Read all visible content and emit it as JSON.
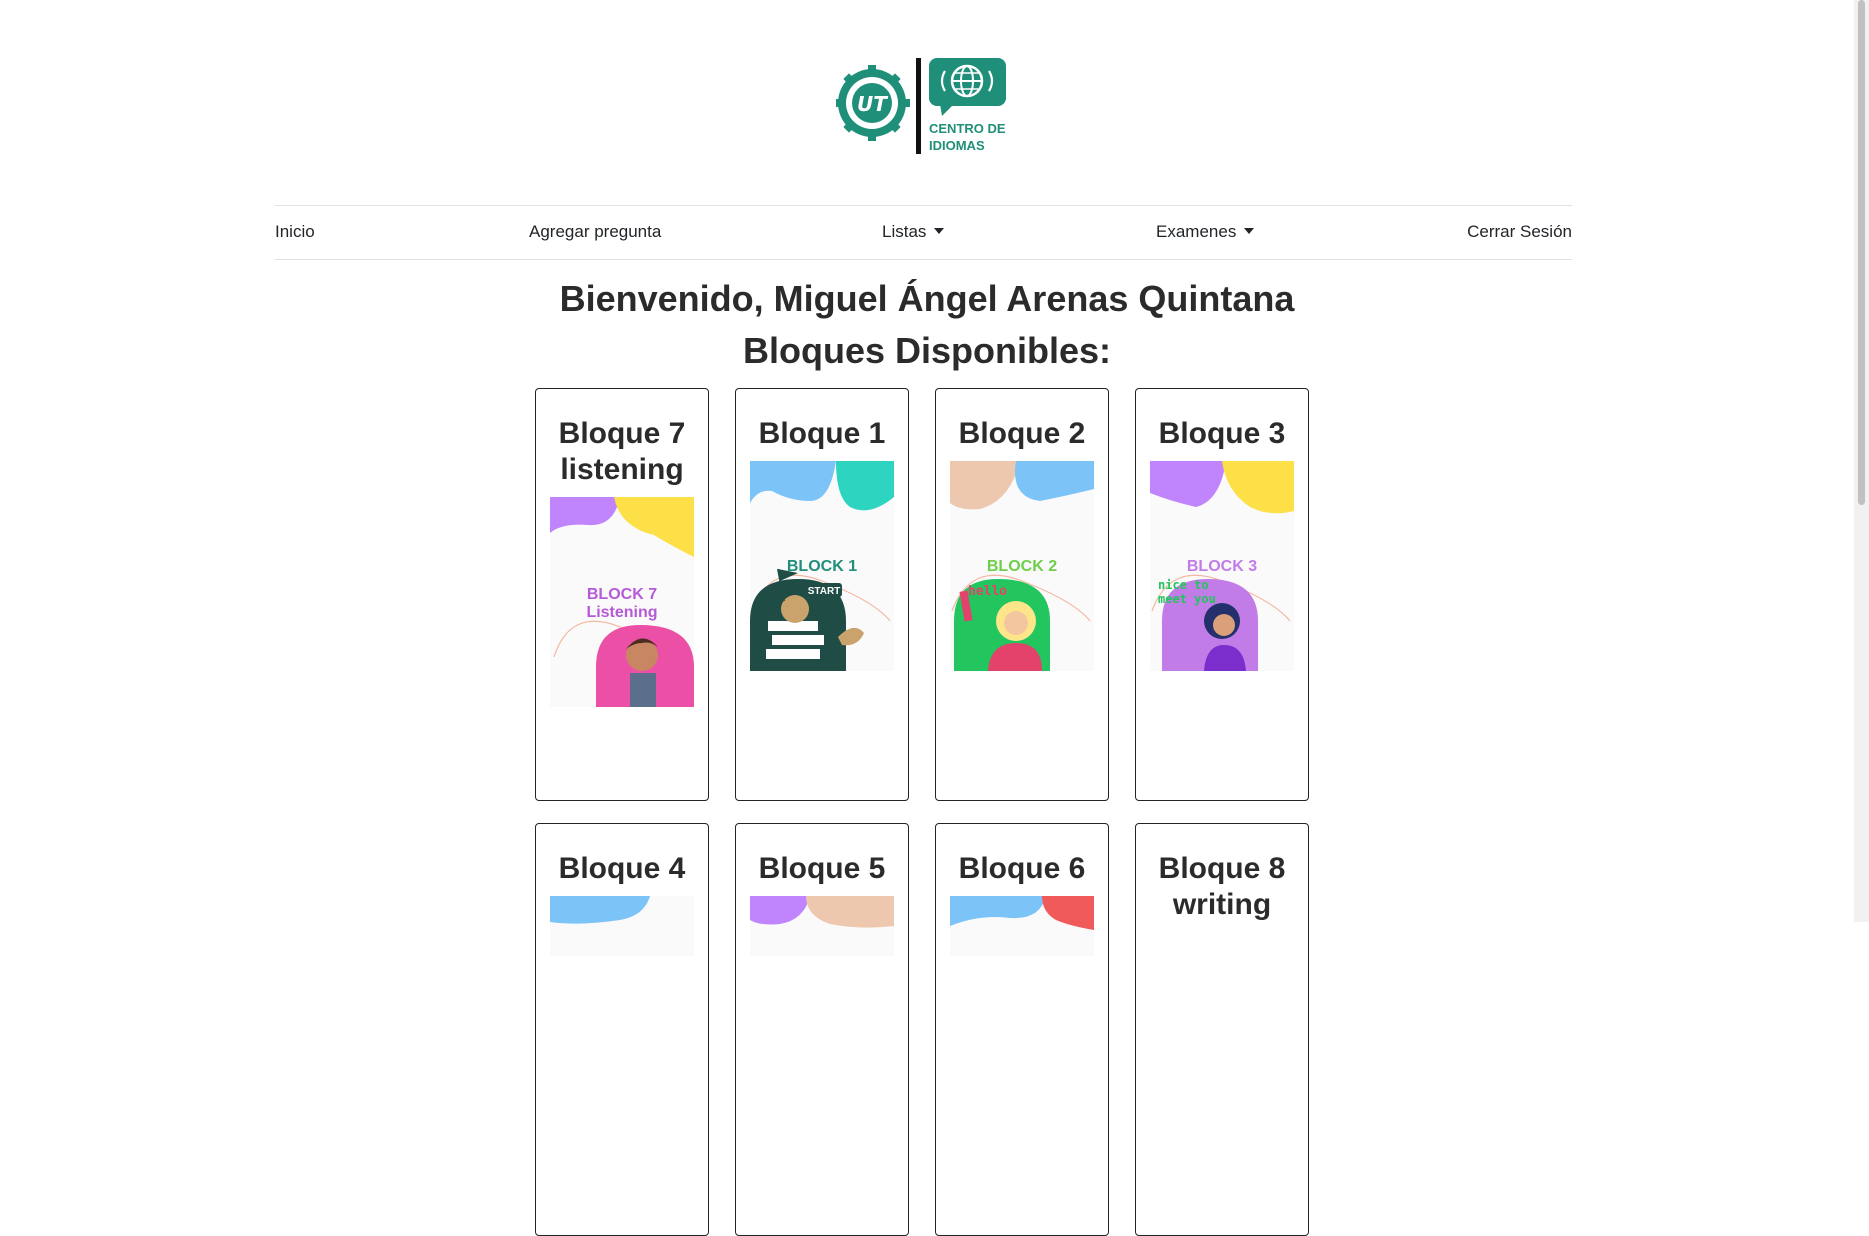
{
  "logo": {
    "label_line1": "CENTRO DE",
    "label_line2": "IDIOMAS",
    "seal_text": "UT"
  },
  "nav": {
    "inicio": "Inicio",
    "agregar": "Agregar pregunta",
    "listas": "Listas",
    "examenes": "Examenes",
    "cerrar": "Cerrar Sesión"
  },
  "welcome": "Bienvenido, Miguel Ángel Arenas Quintana",
  "blocks_heading": "Bloques Disponibles:",
  "cards": [
    {
      "title_line1": "Bloque 7",
      "title_line2": "listening",
      "img_line1": "BLOCK 7",
      "img_line2": "Listening"
    },
    {
      "title_line1": "Bloque 1",
      "img_line1": "BLOCK 1",
      "img_tag": "START"
    },
    {
      "title_line1": "Bloque 2",
      "img_line1": "BLOCK 2",
      "img_tag": "hello"
    },
    {
      "title_line1": "Bloque 3",
      "img_line1": "BLOCK 3",
      "img_tag": "nice to",
      "img_tag2": "meet you"
    },
    {
      "title_line1": "Bloque 4"
    },
    {
      "title_line1": "Bloque 5"
    },
    {
      "title_line1": "Bloque 6"
    },
    {
      "title_line1": "Bloque 8",
      "title_line2": "writing"
    }
  ],
  "colors": {
    "brand": "#1f8f7a",
    "purple": "#c084fc",
    "yellow": "#fde047",
    "blue": "#7cc4f8",
    "teal": "#2dd4bf"
  }
}
